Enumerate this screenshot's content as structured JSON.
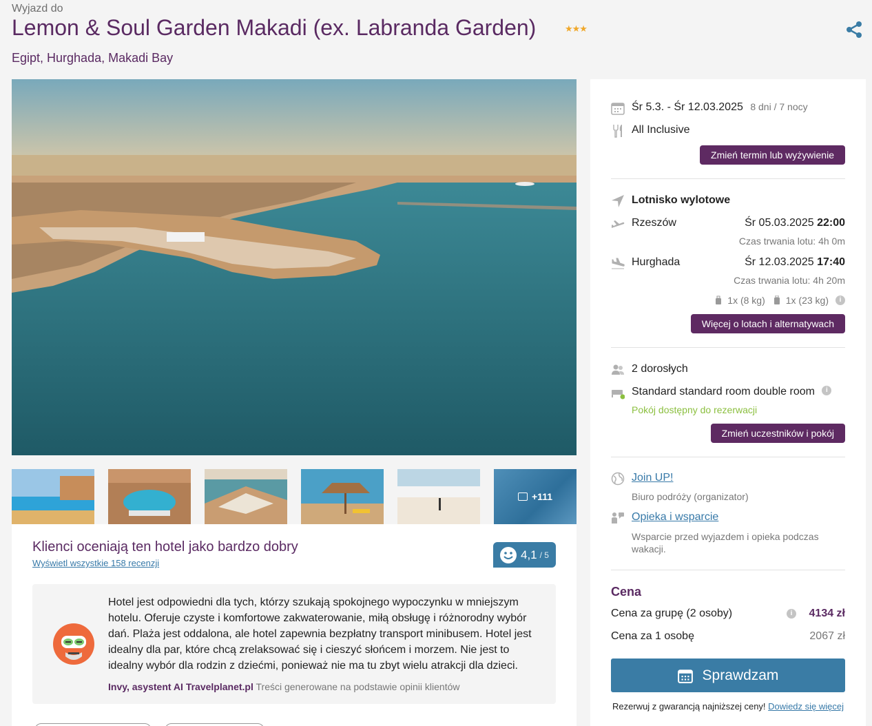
{
  "header": {
    "trip_to": "Wyjazd do",
    "hotel_name": "Lemon & Soul Garden Makadi (ex. Labranda Garden)",
    "stars": "★★★",
    "location": "Egipt, Hurghada, Makadi Bay"
  },
  "gallery": {
    "more_count": "+111"
  },
  "reviews": {
    "title": "Klienci oceniają ten hotel jako bardzo dobry",
    "link": "Wyświetl wszystkie 158 recenzji",
    "score": "4,1",
    "score_max": "/ 5",
    "ai_text": "Hotel jest odpowiedni dla tych, którzy szukają spokojnego wypoczynku w mniejszym hotelu. Oferuje czyste i komfortowe zakwaterowanie, miłą obsługę i różnorodny wybór dań. Plaża jest oddalona, ale hotel zapewnia bezpłatny transport minibusem. Hotel jest idealny dla par, które chcą zrelaksować się i cieszyć słońcem i morzem. Nie jest to idealny wybór dla rodzin z dziećmi, ponieważ nie ma tu zbyt wielu atrakcji dla dzieci.",
    "ai_author": "Invy, asystent AI Travelplanet.pl",
    "ai_note": "Treści generowane na podstawie opinii klientów"
  },
  "booking": {
    "dates": "Śr 5.3. - Śr 12.03.2025",
    "duration": "8 dni / 7 nocy",
    "board": "All Inclusive",
    "change_date_btn": "Zmień termin lub wyżywienie",
    "airport_title": "Lotnisko wylotowe",
    "outbound_city": "Rzeszów",
    "outbound_date": "Śr 05.03.2025",
    "outbound_time": "22:00",
    "outbound_duration": "Czas trwania lotu: 4h 0m",
    "return_city": "Hurghada",
    "return_date": "Śr 12.03.2025",
    "return_time": "17:40",
    "return_duration": "Czas trwania lotu: 4h 20m",
    "hand_luggage": "1x (8 kg)",
    "checked_luggage": "1x (23 kg)",
    "flights_btn": "Więcej o lotach i alternatywach",
    "travellers": "2 dorosłych",
    "room": "Standard standard room double room",
    "room_status": "Pokój dostępny do rezerwacji",
    "change_room_btn": "Zmień uczestników i pokój",
    "organizer_link": "Join UP!",
    "organizer_desc": "Biuro podróży (organizator)",
    "support_link": "Opieka i wsparcie",
    "support_desc": "Wsparcie przed wyjazdem i opieka podczas wakacji.",
    "price_title": "Cena",
    "group_label": "Cena za grupę (2 osoby)",
    "group_price": "4134 zł",
    "person_label": "Cena za 1 osobę",
    "person_price": "2067 zł",
    "cta": "Sprawdzam",
    "guarantee": "Rezerwuj z gwarancją najniższej ceny!",
    "guarantee_link": "Dowiedz się więcej"
  },
  "colors": {
    "brand_purple": "#5e2a62",
    "accent_blue": "#3a7ca5",
    "available_green": "#8bbf3f",
    "star_gold": "#f0a82b"
  }
}
